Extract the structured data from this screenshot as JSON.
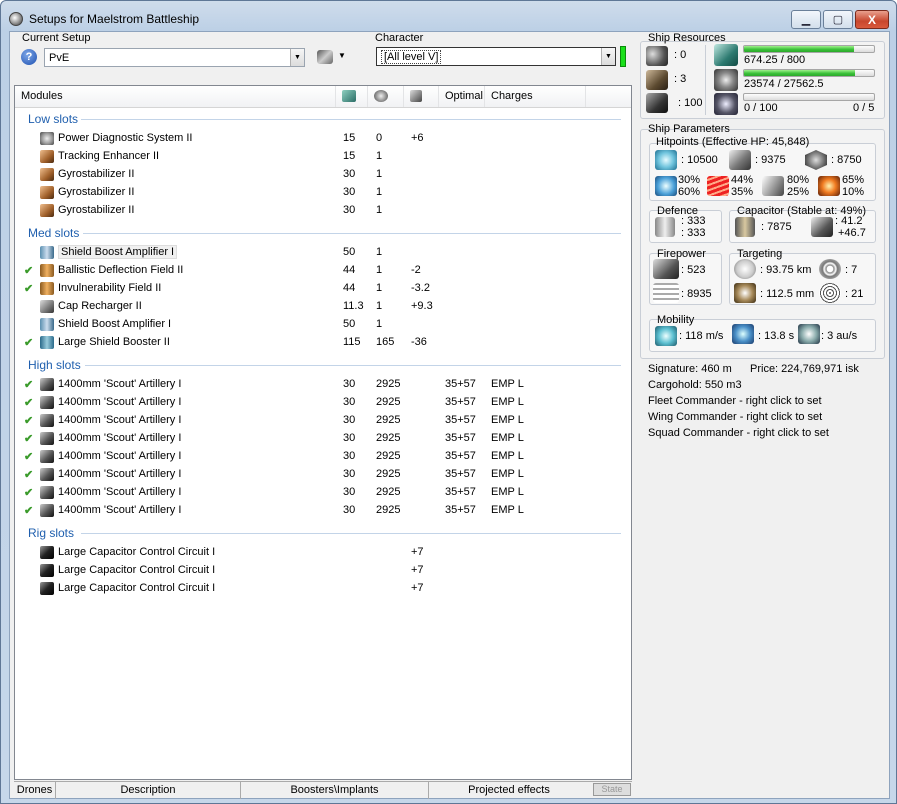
{
  "window": {
    "title": "Setups for Maelstrom Battleship",
    "minimize": "▁",
    "maximize": "▢",
    "close": "X"
  },
  "setup": {
    "label": "Current Setup",
    "value": "PvE",
    "help": "?",
    "menu_arrow": "▼"
  },
  "character": {
    "label": "Character",
    "value": "[All level V]"
  },
  "modules_header": {
    "modules": "Modules",
    "optimal": "Optimal",
    "charges": "Charges"
  },
  "groups": {
    "low": "Low slots",
    "med": "Med slots",
    "high": "High slots",
    "rig": "Rig slots"
  },
  "low_rows": [
    {
      "check": "",
      "name": "Power Diagnostic System II",
      "cpu": "15",
      "pg": "0",
      "cap": "+6",
      "optimal": "",
      "charges": ""
    },
    {
      "check": "",
      "name": "Tracking Enhancer II",
      "cpu": "15",
      "pg": "1",
      "cap": "",
      "optimal": "",
      "charges": ""
    },
    {
      "check": "",
      "name": "Gyrostabilizer II",
      "cpu": "30",
      "pg": "1",
      "cap": "",
      "optimal": "",
      "charges": ""
    },
    {
      "check": "",
      "name": "Gyrostabilizer II",
      "cpu": "30",
      "pg": "1",
      "cap": "",
      "optimal": "",
      "charges": ""
    },
    {
      "check": "",
      "name": "Gyrostabilizer II",
      "cpu": "30",
      "pg": "1",
      "cap": "",
      "optimal": "",
      "charges": ""
    }
  ],
  "med_rows": [
    {
      "check": "",
      "name": "Shield Boost Amplifier I",
      "cpu": "50",
      "pg": "1",
      "cap": "",
      "optimal": "",
      "charges": ""
    },
    {
      "check": "✔",
      "name": "Ballistic Deflection Field II",
      "cpu": "44",
      "pg": "1",
      "cap": "-2",
      "optimal": "",
      "charges": ""
    },
    {
      "check": "✔",
      "name": "Invulnerability Field II",
      "cpu": "44",
      "pg": "1",
      "cap": "-3.2",
      "optimal": "",
      "charges": ""
    },
    {
      "check": "",
      "name": "Cap Recharger II",
      "cpu": "11.3",
      "pg": "1",
      "cap": "+9.3",
      "optimal": "",
      "charges": ""
    },
    {
      "check": "",
      "name": "Shield Boost Amplifier I",
      "cpu": "50",
      "pg": "1",
      "cap": "",
      "optimal": "",
      "charges": ""
    },
    {
      "check": "✔",
      "name": "Large Shield Booster II",
      "cpu": "115",
      "pg": "165",
      "cap": "-36",
      "optimal": "",
      "charges": ""
    }
  ],
  "high_rows": [
    {
      "check": "✔",
      "name": "1400mm 'Scout' Artillery I",
      "cpu": "30",
      "pg": "2925",
      "cap": "",
      "optimal": "35+57",
      "charges": "EMP L"
    },
    {
      "check": "✔",
      "name": "1400mm 'Scout' Artillery I",
      "cpu": "30",
      "pg": "2925",
      "cap": "",
      "optimal": "35+57",
      "charges": "EMP L"
    },
    {
      "check": "✔",
      "name": "1400mm 'Scout' Artillery I",
      "cpu": "30",
      "pg": "2925",
      "cap": "",
      "optimal": "35+57",
      "charges": "EMP L"
    },
    {
      "check": "✔",
      "name": "1400mm 'Scout' Artillery I",
      "cpu": "30",
      "pg": "2925",
      "cap": "",
      "optimal": "35+57",
      "charges": "EMP L"
    },
    {
      "check": "✔",
      "name": "1400mm 'Scout' Artillery I",
      "cpu": "30",
      "pg": "2925",
      "cap": "",
      "optimal": "35+57",
      "charges": "EMP L"
    },
    {
      "check": "✔",
      "name": "1400mm 'Scout' Artillery I",
      "cpu": "30",
      "pg": "2925",
      "cap": "",
      "optimal": "35+57",
      "charges": "EMP L"
    },
    {
      "check": "✔",
      "name": "1400mm 'Scout' Artillery I",
      "cpu": "30",
      "pg": "2925",
      "cap": "",
      "optimal": "35+57",
      "charges": "EMP L"
    },
    {
      "check": "✔",
      "name": "1400mm 'Scout' Artillery I",
      "cpu": "30",
      "pg": "2925",
      "cap": "",
      "optimal": "35+57",
      "charges": "EMP L"
    }
  ],
  "rig_rows": [
    {
      "check": "",
      "name": "Large Capacitor Control Circuit I",
      "cpu": "",
      "pg": "",
      "cap": "+7",
      "optimal": "",
      "charges": ""
    },
    {
      "check": "",
      "name": "Large Capacitor Control Circuit I",
      "cpu": "",
      "pg": "",
      "cap": "+7",
      "optimal": "",
      "charges": ""
    },
    {
      "check": "",
      "name": "Large Capacitor Control Circuit I",
      "cpu": "",
      "pg": "",
      "cap": "+7",
      "optimal": "",
      "charges": ""
    }
  ],
  "bottom_tabs": {
    "drones": "Drones",
    "description": "Description",
    "boosters": "Boosters\\Implants",
    "projected": "Projected effects",
    "state": "State"
  },
  "resources": {
    "title": "Ship Resources",
    "turrets": ": 0",
    "launchers": ": 3",
    "calibration": ": 100",
    "cpu_text": "674.25 / 800",
    "cpu_fraction": 0.843,
    "pg_text": "23574 / 27562.5",
    "pg_fraction": 0.855,
    "drone_bay": "0 / 100",
    "drones_active": "0 / 5",
    "drone_fraction": 0
  },
  "params": {
    "title": "Ship Parameters",
    "hp_title": "Hitpoints (Effective HP: 45,848)",
    "shield_hp": ": 10500",
    "armor_hp": ": 9375",
    "structure_hp": ": 8750",
    "res1_top": "30%",
    "res1_bot": "60%",
    "res2_top": "44%",
    "res2_bot": "35%",
    "res3_top": "80%",
    "res3_bot": "25%",
    "res4_top": "65%",
    "res4_bot": "10%",
    "defence_title": "Defence",
    "def_top": ": 333",
    "def_bot": ": 333",
    "cap_title": "Capacitor (Stable at: 49%)",
    "cap_amount": ": 7875",
    "cap_top": ": 41.2",
    "cap_bot": "+46.7",
    "fp_title": "Firepower",
    "fp_top": ": 523",
    "fp_bot": ": 8935",
    "tgt_title": "Targeting",
    "tgt_range": ": 93.75 km",
    "tgt_count": ": 7",
    "tgt_res": ": 112.5 mm",
    "tgt_sensor": ": 21",
    "mob_title": "Mobility",
    "mob_speed": ": 118 m/s",
    "mob_align": ": 13.8 s",
    "mob_warp": ": 3 au/s"
  },
  "info": {
    "signature": "Signature: 460 m",
    "price": "Price: 224,769,971 isk",
    "cargo": "Cargohold: 550 m3",
    "fleet": "Fleet Commander - right click to set",
    "wing": "Wing Commander - right click to set",
    "squad": "Squad Commander - right click to set"
  }
}
